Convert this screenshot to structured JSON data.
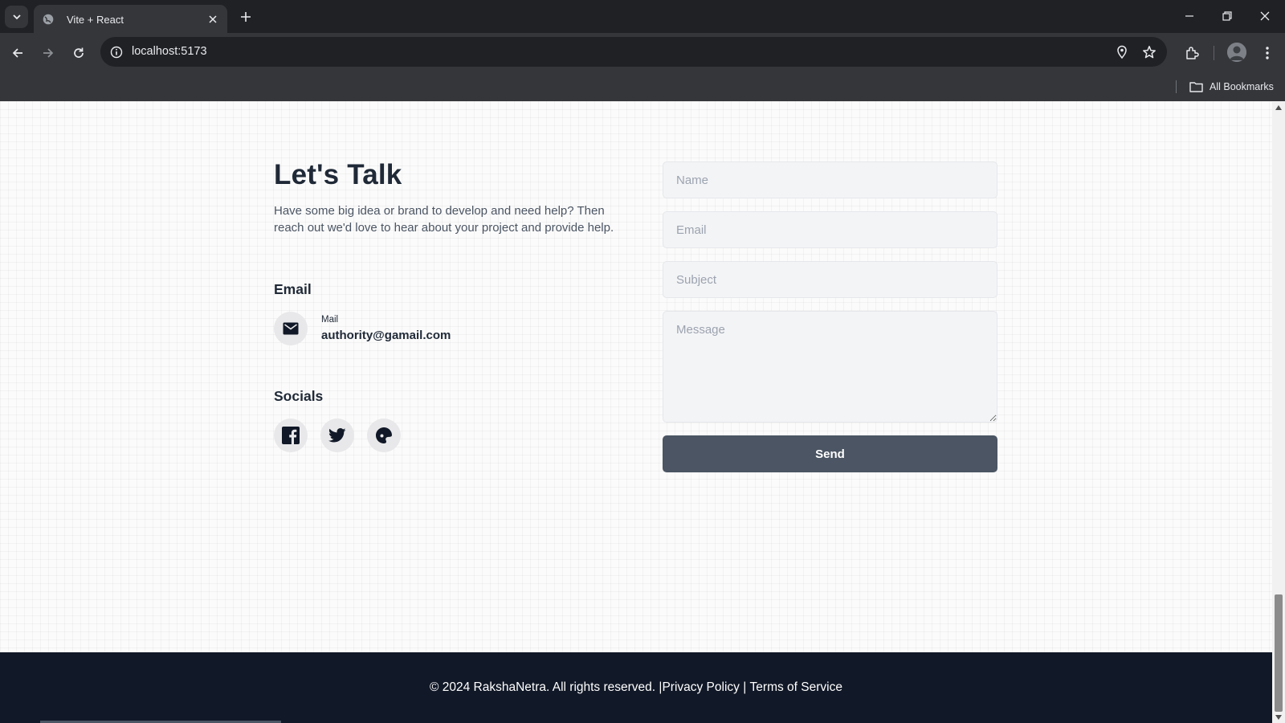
{
  "browser": {
    "tab_title": "Vite + React",
    "url": "localhost:5173",
    "bookmarks_label": "All Bookmarks"
  },
  "page": {
    "title": "Let's Talk",
    "intro": "Have some big idea or brand to develop and need help? Then reach out we'd love to hear about your project and provide help.",
    "email_section": {
      "heading": "Email",
      "mail_label": "Mail",
      "mail_value": "authority@gamail.com"
    },
    "socials_section": {
      "heading": "Socials",
      "icons": [
        "facebook-icon",
        "twitter-icon",
        "threads-icon"
      ]
    },
    "form": {
      "name_placeholder": "Name",
      "email_placeholder": "Email",
      "subject_placeholder": "Subject",
      "message_placeholder": "Message",
      "send_label": "Send"
    },
    "footer": {
      "copyright": "© 2024 RakshaNetra. All rights reserved. |",
      "privacy": "Privacy Policy",
      "separator": " | ",
      "terms": "Terms of Service"
    }
  },
  "colors": {
    "footer_bg": "#111827",
    "send_button": "#4b5563",
    "heading_text": "#1f2937",
    "field_bg": "#f3f4f6"
  }
}
